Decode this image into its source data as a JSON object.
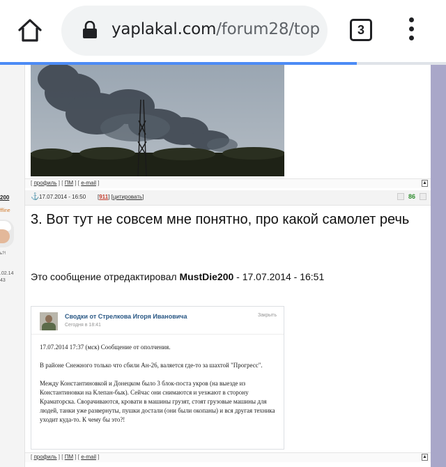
{
  "browser": {
    "url_domain": "yaplakal.com",
    "url_path": "/forum28/top",
    "tab_count": "3",
    "load_progress_percent": 80
  },
  "top_post": {
    "links": {
      "profile": "профиль",
      "pm": "ПМ",
      "email": "e-mail"
    }
  },
  "post": {
    "user": {
      "name_fragment": "200",
      "status": "ffline",
      "note": "ь?!",
      "reg_line1": ".02.14",
      "reg_line2": "43"
    },
    "date": "17.07.2014 - 16:50",
    "number": "911",
    "quote_label": "цитировать",
    "rating": "86",
    "headline": "3. Вот тут не совсем мне понятно, про какой самолет речь",
    "edited_prefix": "Это сообщение отредактировал",
    "edited_user": "MustDie200",
    "edited_suffix": "- 17.07.2014 - 16:51",
    "card": {
      "title": "Сводки от Стрелкова Игоря Ивановича",
      "time": "Сегодня в 18:41",
      "close_label": "Закрыть",
      "paragraphs": [
        "17.07.2014 17:37 (мск) Сообщение от ополчения.",
        "В районе Снежного только что сбили Ан-26, валяется где-то за шахтой \"Прогресс\".",
        "Между Константиновкой и Донецком было 3 блок-поста укров (на выезде из Константиновки на Клепан-бык). Сейчас они снимаются и уезжают в сторону Краматорска. Сворачиваются, кровати в машины грузят, стоят грузовые машины для людей, танки уже развернуты, пушки достали (они были окопаны) и вся другая техника уходит куда-то. К чему бы это?!"
      ]
    },
    "links": {
      "profile": "профиль",
      "pm": "ПМ",
      "email": "e-mail"
    }
  },
  "colors": {
    "accent": "#4c8bf5",
    "rail": "#a9a7c9",
    "link": "#2a5885",
    "post_number": "#c0392b",
    "rating": "#2e8b2e"
  }
}
